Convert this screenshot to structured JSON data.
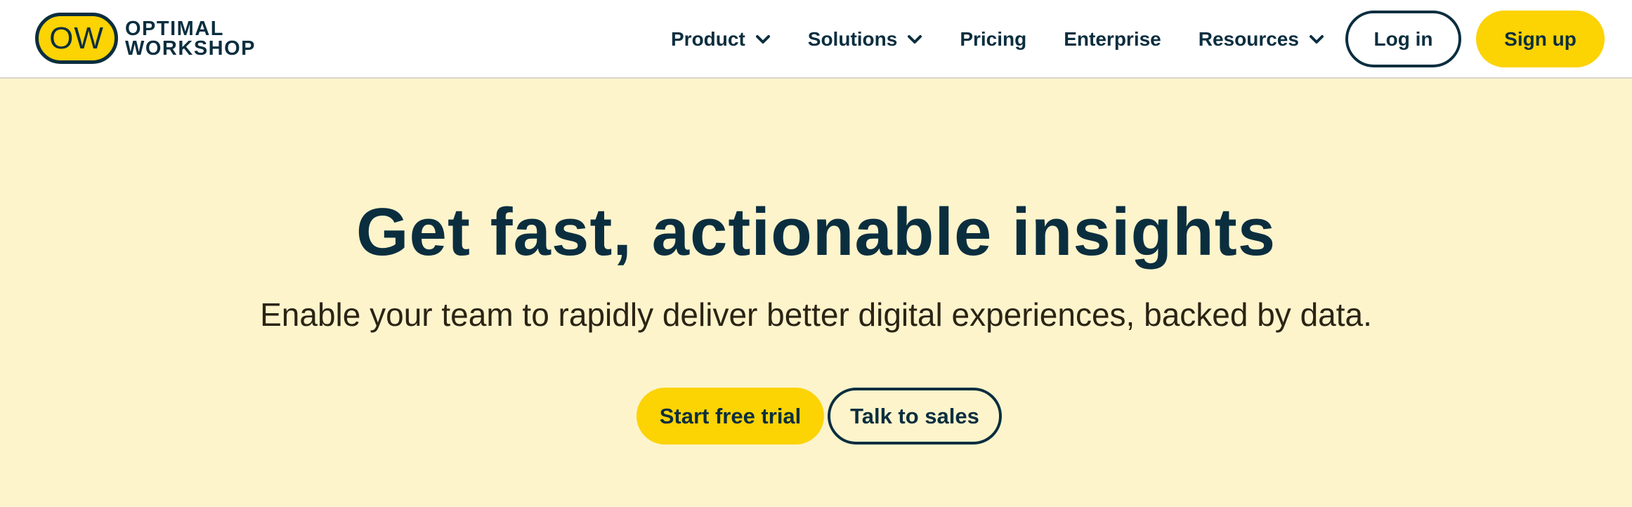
{
  "header": {
    "logo": {
      "badge_text": "OW",
      "line1": "OPTIMAL",
      "line2": "WORKSHOP"
    },
    "nav": [
      {
        "label": "Product",
        "has_dropdown": true
      },
      {
        "label": "Solutions",
        "has_dropdown": true
      },
      {
        "label": "Pricing",
        "has_dropdown": false
      },
      {
        "label": "Enterprise",
        "has_dropdown": false
      },
      {
        "label": "Resources",
        "has_dropdown": true
      }
    ],
    "login_label": "Log in",
    "signup_label": "Sign up"
  },
  "hero": {
    "title": "Get fast, actionable insights",
    "subtitle": "Enable your team to rapidly deliver better digital experiences, backed by data.",
    "primary_cta": "Start free trial",
    "secondary_cta": "Talk to sales"
  },
  "colors": {
    "brand_yellow": "#fcd303",
    "navy": "#0b2e3f",
    "hero_background": "#fdf4cc",
    "header_background": "#ffffff"
  },
  "icons": {
    "dropdown": "chevron-down-icon"
  }
}
